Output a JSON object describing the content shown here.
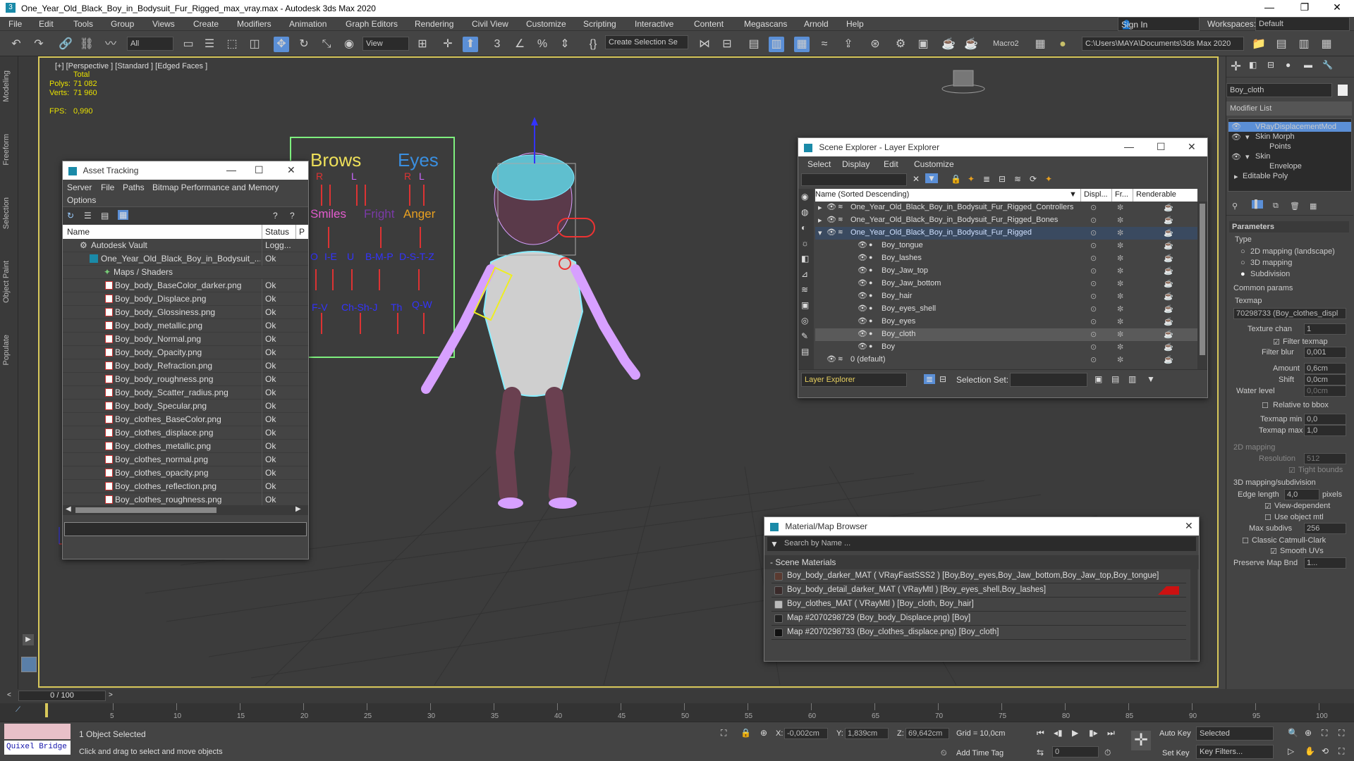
{
  "window": {
    "title": "One_Year_Old_Black_Boy_in_Bodysuit_Fur_Rigged_max_vray.max - Autodesk 3ds Max 2020"
  },
  "menu": [
    "File",
    "Edit",
    "Tools",
    "Group",
    "Views",
    "Create",
    "Modifiers",
    "Animation",
    "Graph Editors",
    "Rendering",
    "Civil View",
    "Customize",
    "Scripting",
    "Interactive",
    "Content",
    "Megascans",
    "Arnold",
    "Help"
  ],
  "account": {
    "sign_in": "Sign In",
    "workspaces_label": "Workspaces:",
    "workspace": "Default"
  },
  "toolbar": {
    "filter": "All",
    "view": "View",
    "selection_set": "Create Selection Se",
    "macro": "Macro2",
    "path": "C:\\Users\\MAYA\\Documents\\3ds Max 2020"
  },
  "side_tabs": [
    "Modeling",
    "Freeform",
    "Selection",
    "Object Paint",
    "Populate"
  ],
  "viewport": {
    "label": "[+] [Perspective ] [Standard ] [Edged Faces ]",
    "stats_header": "Total",
    "polys_label": "Polys:",
    "polys": "71 082",
    "verts_label": "Verts:",
    "verts": "71 960",
    "fps_label": "FPS:",
    "fps": "0,990"
  },
  "face_board": {
    "brows": "Brows",
    "eyes": "Eyes",
    "r": "R",
    "l": "L",
    "smiles": "Smiles",
    "fright": "Fright",
    "anger": "Anger",
    "o": "O",
    "ie": "I-E",
    "u": "U",
    "bmp": "B-M-P",
    "dstz": "D-S-T-Z",
    "fv": "F-V",
    "chshj": "Ch-Sh-J",
    "th": "Th",
    "qw": "Q-W"
  },
  "asset_tracking": {
    "title": "Asset Tracking",
    "menu": [
      "Server",
      "File",
      "Paths",
      "Bitmap Performance and Memory"
    ],
    "menu2": "Options",
    "col_name": "Name",
    "col_status": "Status",
    "col_p": "P",
    "vault": "Autodesk Vault",
    "vault_status": "Logg...",
    "file": "One_Year_Old_Black_Boy_in_Bodysuit_...",
    "file_status": "Ok",
    "maps": "Maps / Shaders",
    "items": [
      {
        "name": "Boy_body_BaseColor_darker.png",
        "status": "Ok"
      },
      {
        "name": "Boy_body_Displace.png",
        "status": "Ok"
      },
      {
        "name": "Boy_body_Glossiness.png",
        "status": "Ok"
      },
      {
        "name": "Boy_body_metallic.png",
        "status": "Ok"
      },
      {
        "name": "Boy_body_Normal.png",
        "status": "Ok"
      },
      {
        "name": "Boy_body_Opacity.png",
        "status": "Ok"
      },
      {
        "name": "Boy_body_Refraction.png",
        "status": "Ok"
      },
      {
        "name": "Boy_body_roughness.png",
        "status": "Ok"
      },
      {
        "name": "Boy_body_Scatter_radius.png",
        "status": "Ok"
      },
      {
        "name": "Boy_body_Specular.png",
        "status": "Ok"
      },
      {
        "name": "Boy_clothes_BaseColor.png",
        "status": "Ok"
      },
      {
        "name": "Boy_clothes_displace.png",
        "status": "Ok"
      },
      {
        "name": "Boy_clothes_metallic.png",
        "status": "Ok"
      },
      {
        "name": "Boy_clothes_normal.png",
        "status": "Ok"
      },
      {
        "name": "Boy_clothes_opacity.png",
        "status": "Ok"
      },
      {
        "name": "Boy_clothes_reflection.png",
        "status": "Ok"
      },
      {
        "name": "Boy_clothes_roughness.png",
        "status": "Ok"
      }
    ]
  },
  "scene_explorer": {
    "title": "Scene Explorer - Layer Explorer",
    "menu": [
      "Select",
      "Display",
      "Edit",
      "Customize"
    ],
    "col_name": "Name (Sorted Descending)",
    "col_disp": "Displ...",
    "col_fr": "Fr...",
    "col_render": "Renderable",
    "rows": [
      {
        "name": "One_Year_Old_Black_Boy_in_Bodysuit_Fur_Rigged_Controllers"
      },
      {
        "name": "One_Year_Old_Black_Boy_in_Bodysuit_Fur_Rigged_Bones"
      },
      {
        "name": "One_Year_Old_Black_Boy_in_Bodysuit_Fur_Rigged"
      },
      {
        "name": "Boy_tongue"
      },
      {
        "name": "Boy_lashes"
      },
      {
        "name": "Boy_Jaw_top"
      },
      {
        "name": "Boy_Jaw_bottom"
      },
      {
        "name": "Boy_hair"
      },
      {
        "name": "Boy_eyes_shell"
      },
      {
        "name": "Boy_eyes"
      },
      {
        "name": "Boy_cloth"
      },
      {
        "name": "Boy"
      },
      {
        "name": "0 (default)"
      }
    ],
    "footer_explorer": "Layer Explorer",
    "footer_selset": "Selection Set:"
  },
  "material_browser": {
    "title": "Material/Map Browser",
    "search": "Search by Name ...",
    "section": "- Scene Materials",
    "items": [
      "Boy_body_darker_MAT ( VRayFastSSS2 ) [Boy,Boy_eyes,Boy_Jaw_bottom,Boy_Jaw_top,Boy_tongue]",
      "Boy_body_detail_darker_MAT ( VRayMtl ) [Boy_eyes_shell,Boy_lashes]",
      "Boy_clothes_MAT  ( VRayMtl ) [Boy_cloth, Boy_hair]",
      "Map #2070298729 (Boy_body_Displace.png) [Boy]",
      "Map #2070298733 (Boy_clothes_displace.png) [Boy_cloth]"
    ]
  },
  "command_panel": {
    "object_name": "Boy_cloth",
    "modifier_list": "Modifier List",
    "stack": [
      "VRayDisplacementMod",
      "Skin Morph",
      "Points",
      "Skin",
      "Envelope",
      "Editable Poly"
    ],
    "parameters": "Parameters",
    "type": "Type",
    "type_opts": [
      "2D mapping (landscape)",
      "3D mapping",
      "Subdivision"
    ],
    "common": "Common params",
    "texmap": "Texmap",
    "texmap_val": "70298733 (Boy_clothes_displ",
    "texture_chan": "Texture chan",
    "texture_chan_val": "1",
    "filter_texmap": "Filter texmap",
    "filter_blur": "Filter blur",
    "filter_blur_val": "0,001",
    "amount": "Amount",
    "amount_val": "0,6cm",
    "shift": "Shift",
    "shift_val": "0,0cm",
    "water": "Water level",
    "water_val": "0,0cm",
    "relative": "Relative to bbox",
    "texmin": "Texmap min",
    "texmin_val": "0,0",
    "texmax": "Texmap max",
    "texmax_val": "1,0",
    "map2d": "2D mapping",
    "resolution": "Resolution",
    "resolution_val": "512",
    "tight": "Tight bounds",
    "map3d": "3D mapping/subdivision",
    "edge": "Edge length",
    "edge_val": "4,0",
    "pixels": "pixels",
    "viewdep": "View-dependent",
    "useobj": "Use object mtl",
    "maxsub": "Max subdivs",
    "maxsub_val": "256",
    "catmull": "Classic Catmull-Clark",
    "smooth": "Smooth UVs",
    "preserve": "Preserve Map Bnd",
    "preserve_val": "1..."
  },
  "timeline": {
    "frame": "0 / 100",
    "ticks": [
      "5",
      "10",
      "15",
      "20",
      "25",
      "30",
      "35",
      "40",
      "45",
      "50",
      "55",
      "60",
      "65",
      "70",
      "75",
      "80",
      "85",
      "90",
      "95",
      "100"
    ]
  },
  "status": {
    "quixel": "Quixel Bridge",
    "selected": "1 Object Selected",
    "hint": "Click and drag to select and move objects",
    "x_label": "X:",
    "x": "-0,002cm",
    "y_label": "Y:",
    "y": "1,839cm",
    "z_label": "Z:",
    "z": "69,642cm",
    "grid": "Grid = 10,0cm",
    "add_time_tag": "Add Time Tag",
    "auto_key": "Auto Key",
    "selected_dd": "Selected",
    "set_key": "Set Key",
    "key_filters": "Key Filters...",
    "frame_val": "0"
  },
  "colors": {
    "accent": "#5b8fd6",
    "viewport_border": "#d8c85a",
    "stats": "#e8e000"
  }
}
